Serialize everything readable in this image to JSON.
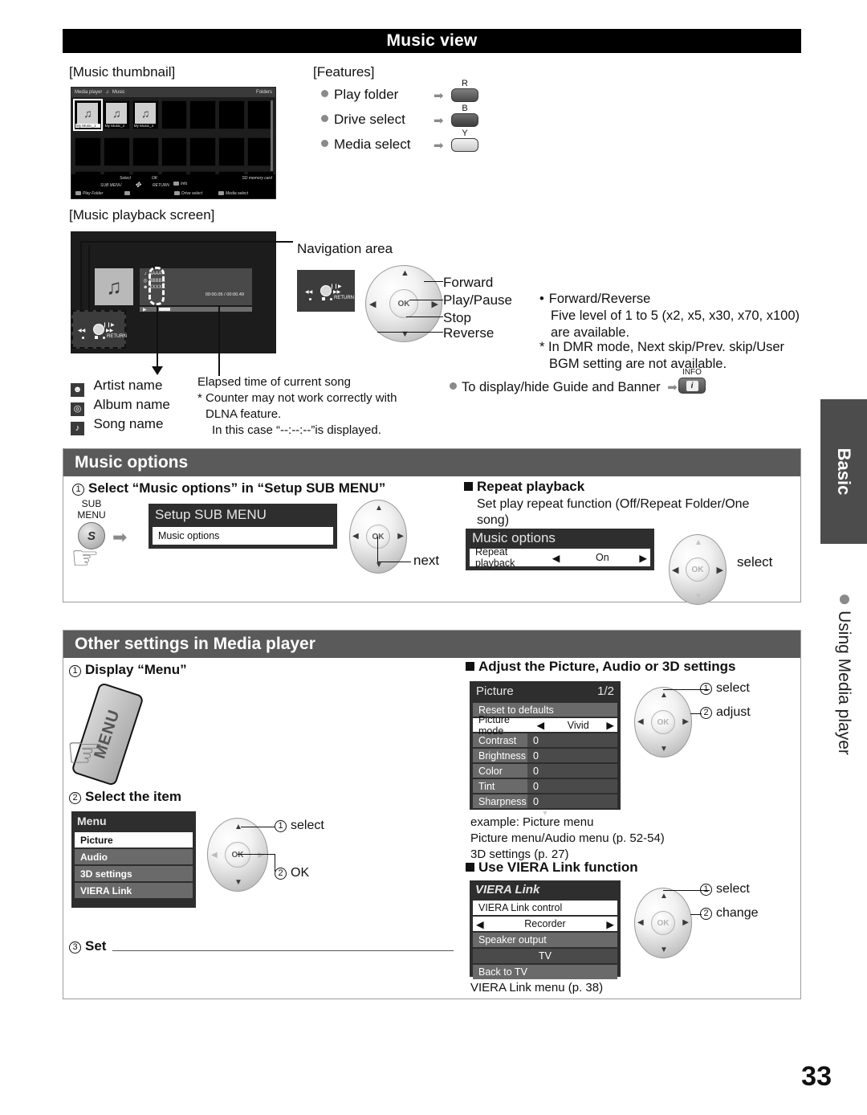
{
  "page": {
    "number": "33"
  },
  "title_bar": {
    "title": "Music view"
  },
  "music_view": {
    "thumbnail_caption": "[Music thumbnail]",
    "playback_caption": "[Music playback screen]",
    "features_caption": "[Features]",
    "features": [
      {
        "label": "Play folder",
        "key": "R"
      },
      {
        "label": "Drive select",
        "key": "B"
      },
      {
        "label": "Media select",
        "key": "Y"
      }
    ],
    "thumbnail_screen": {
      "breadcrumb_app": "Media player",
      "breadcrumb_section": "Music",
      "folders_label": "Folders",
      "items": [
        "My Music_1",
        "My Music_2",
        "My Music_3"
      ],
      "guide": {
        "select": "Select",
        "ok": "OK",
        "info": "Info",
        "card": "SD memory card",
        "sub_menu": "SUB MENU",
        "return": "RETURN",
        "play_folder": "Play Folder",
        "drive_select": "Drive select",
        "media_select": "Media select"
      }
    },
    "playback_screen": {
      "song_line": "AAAA",
      "album_line": "BBBBB",
      "artist_line": "XXXXX",
      "time": "00:00.05 / 00:00.49",
      "return_label": "RETURN"
    },
    "navigation_area_label": "Navigation area",
    "wheel_labels": [
      "Forward",
      "Play/Pause",
      "Stop",
      "Reverse"
    ],
    "ok_label": "OK",
    "legend": [
      {
        "icon": "person-icon",
        "label": "Artist name"
      },
      {
        "icon": "disc-icon",
        "label": "Album name"
      },
      {
        "icon": "note-icon",
        "label": "Song name"
      }
    ],
    "elapsed_note_line1": "Elapsed time of current song",
    "elapsed_note_line2": "* Counter may not work correctly with",
    "elapsed_note_line3": "DLNA feature.",
    "elapsed_note_line4": "In this case “--:--:--”is displayed.",
    "notes": {
      "forward_reverse_title": "Forward/Reverse",
      "forward_reverse_body1": "Five level of 1 to 5 (x2, x5, x30, x70, x100)",
      "forward_reverse_body2": "are available.",
      "dmr_line1": "* In DMR mode, Next skip/Prev. skip/User",
      "dmr_line2": "BGM setting are not available.",
      "guide_banner": "To display/hide Guide and Banner",
      "info_key_caption": "INFO"
    }
  },
  "music_options": {
    "header": "Music options",
    "step1": "Select “Music options” in “Setup SUB MENU”",
    "sub_menu_key_line1": "SUB",
    "sub_menu_key_line2": "MENU",
    "sub_menu_key_glyph": "S",
    "setup_menu": {
      "title": "Setup SUB MENU",
      "item": "Music options"
    },
    "next_label": "next",
    "repeat_title": "Repeat playback",
    "repeat_desc_line1": "Set play repeat function (Off/Repeat Folder/One",
    "repeat_desc_line2": "song)",
    "options_menu": {
      "title": "Music options",
      "row_label": "Repeat playback",
      "row_value": "On"
    },
    "select_label": "select"
  },
  "other_settings": {
    "header": "Other settings in Media player",
    "step1": "Display “Menu”",
    "menu_key_label": "MENU",
    "step2": "Select the item",
    "step3": "Set",
    "menu_panel": {
      "title": "Menu",
      "items": [
        "Picture",
        "Audio",
        "3D settings",
        "VIERA Link"
      ]
    },
    "wheel_steps_left": [
      "select",
      "OK"
    ],
    "adjust_title": "Adjust the Picture, Audio or 3D settings",
    "picture_panel": {
      "title": "Picture",
      "page": "1/2",
      "rows": [
        {
          "label": "Reset to defaults",
          "value": ""
        },
        {
          "label": "Picture mode",
          "value": "Vivid"
        },
        {
          "label": "Contrast",
          "value": "0"
        },
        {
          "label": "Brightness",
          "value": "0"
        },
        {
          "label": "Color",
          "value": "0"
        },
        {
          "label": "Tint",
          "value": "0"
        },
        {
          "label": "Sharpness",
          "value": "0"
        }
      ]
    },
    "wheel_steps_picture": [
      "select",
      "adjust"
    ],
    "example_line1": "example: Picture menu",
    "example_line2": "Picture menu/Audio menu (p. 52-54)",
    "example_line3": "3D settings (p. 27)",
    "viera_title": "Use VIERA Link function",
    "viera_panel": {
      "title": "VIERA Link",
      "rows": [
        {
          "label": "VIERA Link control",
          "value": "Recorder"
        },
        {
          "label": "Speaker output",
          "value": "TV"
        },
        {
          "label": "Back to TV",
          "value": ""
        }
      ]
    },
    "wheel_steps_viera": [
      "select",
      "change"
    ],
    "viera_note": "VIERA Link menu (p. 38)"
  },
  "side_tab": {
    "tab_label": "Basic",
    "sub_label": "Using Media player"
  }
}
